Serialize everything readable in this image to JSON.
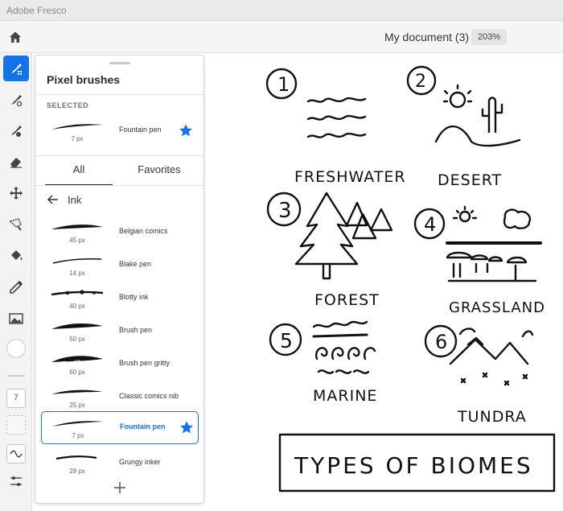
{
  "window": {
    "title": "Adobe Fresco"
  },
  "header": {
    "document_title": "My document (3)",
    "zoom": "203%"
  },
  "toolbar": {
    "tools": [
      {
        "name": "pixel-brush",
        "icon": "pixel-brush-icon",
        "active": true
      },
      {
        "name": "live-brush",
        "icon": "live-brush-icon",
        "active": false
      },
      {
        "name": "vector-brush",
        "icon": "vector-brush-icon",
        "active": false
      },
      {
        "name": "eraser",
        "icon": "eraser-icon",
        "active": false
      },
      {
        "name": "move",
        "icon": "move-icon",
        "active": false
      },
      {
        "name": "lasso",
        "icon": "lasso-icon",
        "active": false
      },
      {
        "name": "fill",
        "icon": "fill-bucket-icon",
        "active": false
      },
      {
        "name": "eyedropper",
        "icon": "eyedropper-icon",
        "active": false
      },
      {
        "name": "image",
        "icon": "image-icon",
        "active": false
      }
    ],
    "brush_size": "7",
    "current_color": "#ffffff"
  },
  "panel": {
    "title": "Pixel brushes",
    "selected_label": "SELECTED",
    "selected_brush": {
      "name": "Fountain pen",
      "size": "7 px",
      "favorite": true
    },
    "tabs": [
      {
        "label": "All",
        "active": true
      },
      {
        "label": "Favorites",
        "active": false
      }
    ],
    "category": "Ink",
    "brushes": [
      {
        "name": "Belgian comics",
        "size": "45 px",
        "favorite": false,
        "selected": false
      },
      {
        "name": "Blake pen",
        "size": "14 px",
        "favorite": false,
        "selected": false
      },
      {
        "name": "Blotty ink",
        "size": "40 px",
        "favorite": false,
        "selected": false
      },
      {
        "name": "Brush pen",
        "size": "50 px",
        "favorite": false,
        "selected": false
      },
      {
        "name": "Brush pen gritty",
        "size": "60 px",
        "favorite": false,
        "selected": false
      },
      {
        "name": "Classic comics nib",
        "size": "25 px",
        "favorite": false,
        "selected": false
      },
      {
        "name": "Fountain pen",
        "size": "7 px",
        "favorite": true,
        "selected": true
      },
      {
        "name": "Grungy inker",
        "size": "28 px",
        "favorite": false,
        "selected": false
      }
    ]
  },
  "canvas": {
    "sections": [
      {
        "number": "1",
        "label": "FRESHWATER"
      },
      {
        "number": "2",
        "label": "DESERT"
      },
      {
        "number": "3",
        "label": "FOREST"
      },
      {
        "number": "4",
        "label": "GRASSLAND"
      },
      {
        "number": "5",
        "label": "MARINE"
      },
      {
        "number": "6",
        "label": "TUNDRA"
      }
    ],
    "banner": "TYPES OF BIOMES"
  },
  "colors": {
    "accent": "#1473e6",
    "star": "#1473e6",
    "ink": "#111111"
  }
}
